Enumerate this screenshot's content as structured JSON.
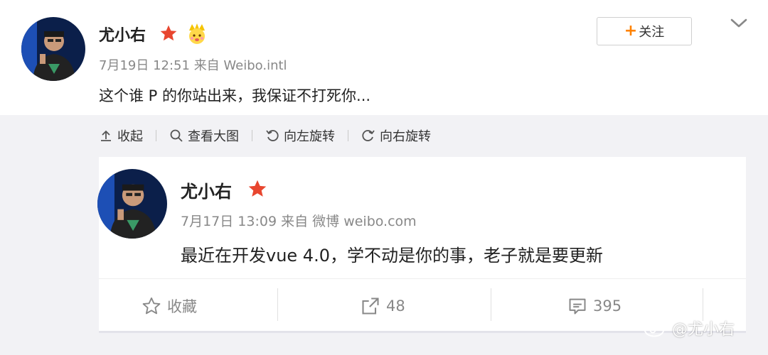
{
  "post": {
    "username": "尤小右",
    "timestamp": "7月19日 12:51",
    "source": "来自 Weibo.intl",
    "text": "这个谁 P 的你站出来，我保证不打死你...",
    "follow_label": "关注",
    "star_icon": "red-star-icon",
    "badge_icon": "crown-emoji-icon",
    "menu_icon": "chevron-down-icon"
  },
  "media_toolbar": {
    "collapse_label": "收起",
    "view_large_label": "查看大图",
    "rotate_left_label": "向左旋转",
    "rotate_right_label": "向右旋转"
  },
  "quoted": {
    "username": "尤小右",
    "timestamp": "7月17日 13:09",
    "source": "来自 微博 weibo.com",
    "text": "最近在开发vue 4.0，学不动是你的事，老子就是要更新",
    "actions": {
      "favorite_label": "收藏",
      "repost_count": "48",
      "comment_count": "395"
    }
  },
  "watermark": {
    "text": "@尤小右"
  },
  "colors": {
    "accent_orange": "#ff8200",
    "star_red": "#e8462f",
    "media_bg": "#f2f2f5"
  }
}
